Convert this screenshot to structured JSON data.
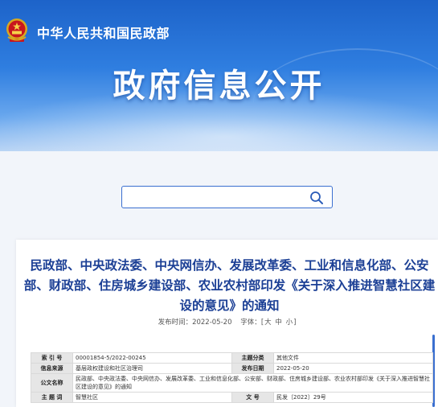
{
  "header": {
    "ministry_name": "中华人民共和国民政部",
    "section_title": "政府信息公开",
    "colors": {
      "banner_top": "#1d63c9",
      "banner_bottom": "#b7d3f4",
      "title_color": "#1b3f95"
    }
  },
  "search": {
    "value": "",
    "placeholder": "",
    "icon": "search-icon"
  },
  "article": {
    "title": "民政部、中央政法委、中央网信办、发展改革委、工业和信息化部、公安部、财政部、住房城乡建设部、农业农村部印发《关于深入推进智慧社区建设的意见》的通知",
    "publish_label": "发布时间：",
    "publish_date": "2022-05-20",
    "font_label": "字体：",
    "font_open": "[",
    "font_large": "大",
    "font_medium": "中",
    "font_small": "小",
    "font_close": "]"
  },
  "info_table": {
    "index_label": "索 引 号",
    "index_value": "00001854-5/2022-00245",
    "topic_label": "主题分类",
    "topic_value": "其他文件",
    "source_label": "信息来源",
    "source_value": "基层政权建设和社区治理司",
    "date_label": "发布日期",
    "date_value": "2022-05-20",
    "doc_title_label": "公文名称",
    "doc_title_value": "民政部、中央政法委、中央网信办、发展改革委、工业和信息化部、公安部、财政部、住房城乡建设部、农业农村部印发《关于深入推进智慧社区建设的意见》的通知",
    "subject_label": "主 题 词",
    "subject_value": "智慧社区",
    "docno_label": "文 号",
    "docno_value": "民发〔2022〕29号"
  }
}
